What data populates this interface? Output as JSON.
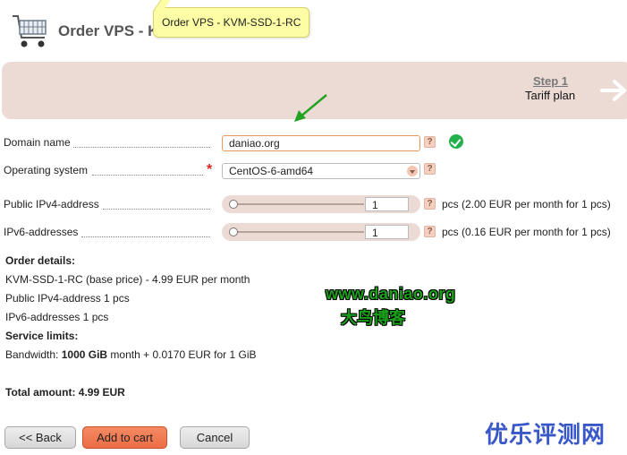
{
  "header": {
    "title": "Order VPS - K",
    "tooltip": "Order VPS - KVM-SSD-1-RC"
  },
  "steps": {
    "step_label": "Step 1",
    "step_name": "Tariff plan"
  },
  "form": {
    "domain": {
      "label": "Domain name",
      "value": "daniao.org",
      "help": "?"
    },
    "os": {
      "label": "Operating system",
      "value": "CentOS-6-amd64",
      "required": "*",
      "help": "?"
    },
    "ipv4": {
      "label": "Public IPv4-address",
      "value": "1",
      "note": "pcs (2.00 EUR per month for 1 pcs)",
      "help": "?",
      "slider_level": 0.0
    },
    "ipv6": {
      "label": "IPv6-addresses",
      "value": "1",
      "note": "pcs (0.16 EUR per month for 1 pcs)",
      "help": "?",
      "slider_level": 0.0
    }
  },
  "order": {
    "details_title": "Order details:",
    "line1": "KVM-SSD-1-RC (base price) - 4.99 EUR per month",
    "line2": "Public IPv4-address 1 pcs",
    "line3": "IPv6-addresses 1 pcs",
    "limits_title": "Service limits:",
    "bandwidth_prefix": "Bandwidth: ",
    "bandwidth_value": "1000 GiB",
    "bandwidth_suffix": " month + 0.0170 EUR for 1 GiB",
    "total": "Total amount: 4.99 EUR"
  },
  "watermarks": {
    "site": "www.daniao.org",
    "site_cn": "大鸟博客",
    "brand_cn": "优乐评测网"
  },
  "buttons": {
    "back": "<< Back",
    "add_to_cart": "Add to cart",
    "cancel": "Cancel"
  },
  "colors": {
    "accent": "#ec6d45",
    "banner": "#ecdbd5",
    "success": "#22b14c",
    "tooltip": "#fdfda6"
  }
}
